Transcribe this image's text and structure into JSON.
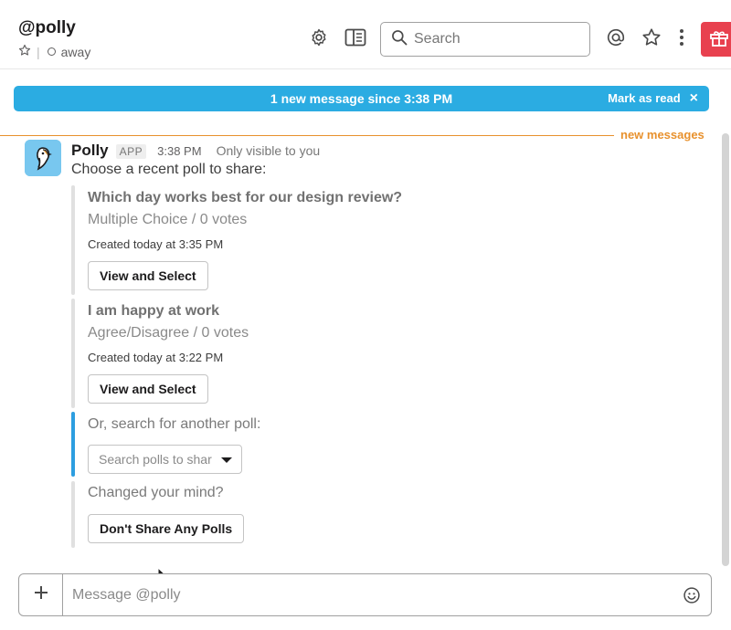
{
  "header": {
    "channel_name": "@polly",
    "separator": "|",
    "presence_text": "away",
    "search_placeholder": "Search"
  },
  "banner": {
    "text": "1 new message since 3:38 PM",
    "mark_as_read": "Mark as read",
    "close_glyph": "×"
  },
  "divider": {
    "label": "new messages"
  },
  "message": {
    "sender": "Polly",
    "app_tag": "APP",
    "time": "3:38 PM",
    "visibility": "Only visible to you",
    "intro": "Choose a recent poll to share:",
    "polls": [
      {
        "title": "Which day works best for our design review?",
        "type_votes": "Multiple Choice / 0 votes",
        "created": "Created today at 3:35 PM",
        "button": "View and Select"
      },
      {
        "title": "I am happy at work",
        "type_votes": "Agree/Disagree / 0 votes",
        "created": "Created today at 3:22 PM",
        "button": "View and Select"
      }
    ],
    "search_prompt": "Or, search for another poll:",
    "search_select_placeholder": "Search polls to share",
    "changed_mind": "Changed your mind?",
    "dont_share_button": "Don't Share Any Polls"
  },
  "composer": {
    "placeholder": "Message @polly"
  },
  "colors": {
    "banner": "#2bace2",
    "new_messages": "#e8912d",
    "accent_bar": "#2d9ee0",
    "gift": "#e8414f",
    "avatar_bg": "#78c7ef"
  },
  "icons": {
    "star": "star-icon",
    "settings": "gear-icon",
    "details": "sidebar-panel-icon",
    "search": "search-icon",
    "mentions": "at-icon",
    "starred": "star-icon",
    "more": "more-vertical-icon",
    "gift": "gift-icon",
    "plus": "plus-icon",
    "emoji": "smiley-icon"
  }
}
